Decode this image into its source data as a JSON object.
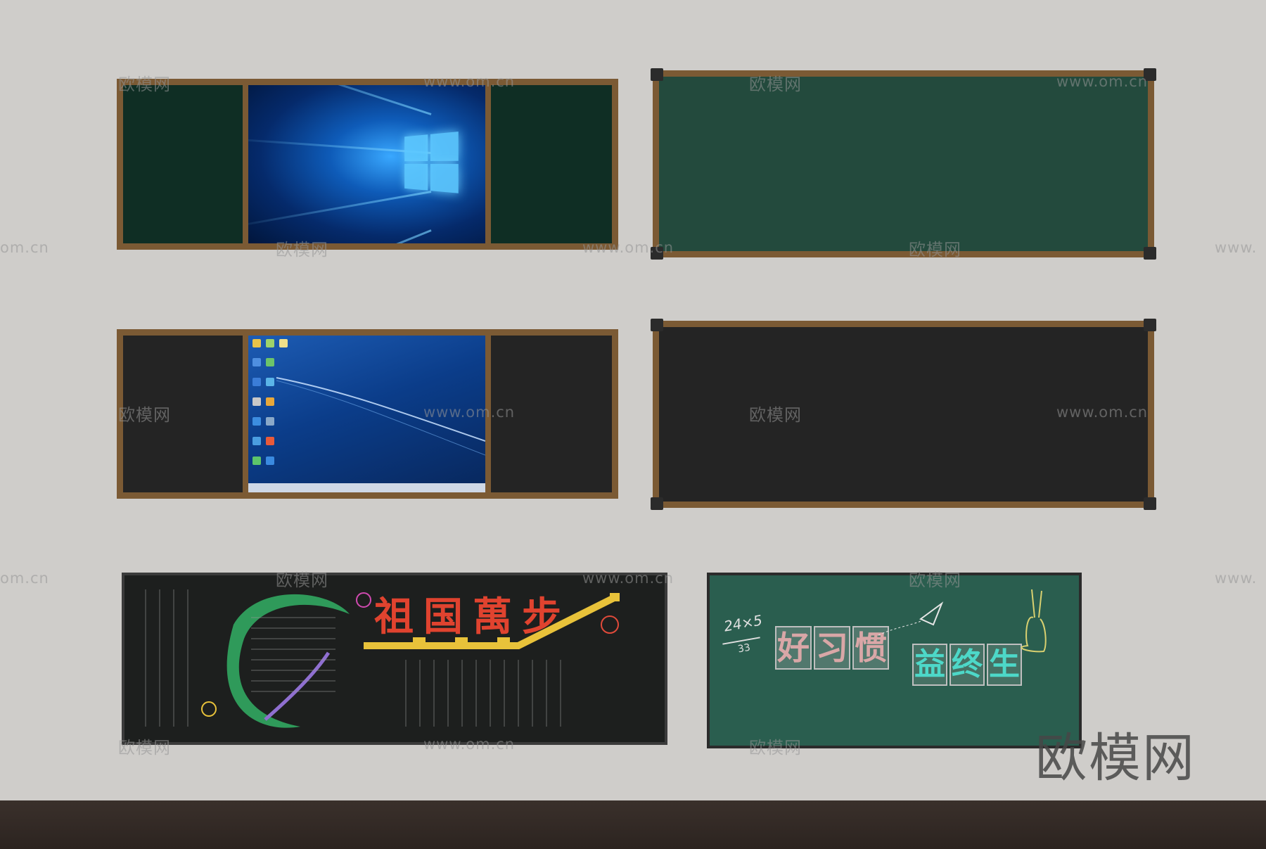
{
  "watermark": {
    "brand": "欧模网",
    "url": "www.om.cn",
    "url_partial_left": "om.cn",
    "url_partial_right": "www."
  },
  "board_patriotic": {
    "title": "祖国萬步"
  },
  "board_habit": {
    "formula_top": "24×5",
    "formula_bottom": "33",
    "words1": [
      "好",
      "习",
      "惯"
    ],
    "words2": [
      "益",
      "终",
      "生"
    ]
  },
  "colors": {
    "wall": "#cfcdca",
    "frame_wood": "#7b5a34",
    "board_green": "#0f2e24",
    "board_green_light": "#234a3d",
    "board_black": "#242424",
    "floor": "#3a302b"
  }
}
